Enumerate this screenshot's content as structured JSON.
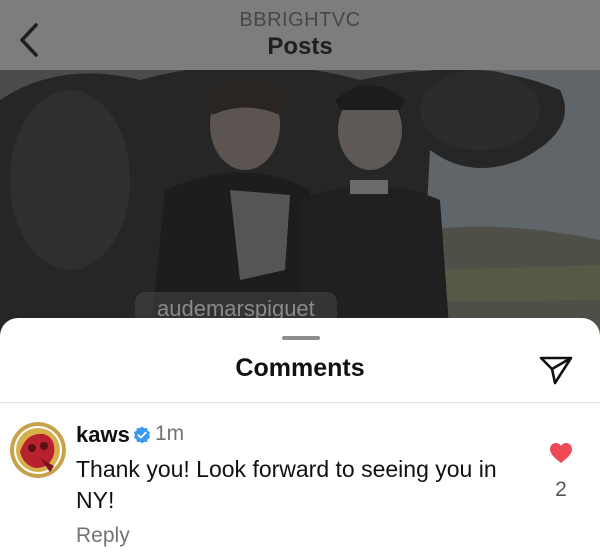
{
  "header": {
    "account": "BBRIGHTVC",
    "title": "Posts",
    "back_icon": "chevron-left-icon"
  },
  "post": {
    "location_tag": "audemarspiguet"
  },
  "comments_sheet": {
    "title": "Comments",
    "send_icon": "paper-plane-icon"
  },
  "comment": {
    "username": "kaws",
    "verified": true,
    "time": "1m",
    "text": "Thank you! Look forward to seeing you in NY!",
    "reply_label": "Reply",
    "like_count": "2",
    "liked": true
  },
  "colors": {
    "like_red": "#ed4956",
    "verified_blue": "#3897f0",
    "overlay_gray": "#7d7d7d"
  }
}
